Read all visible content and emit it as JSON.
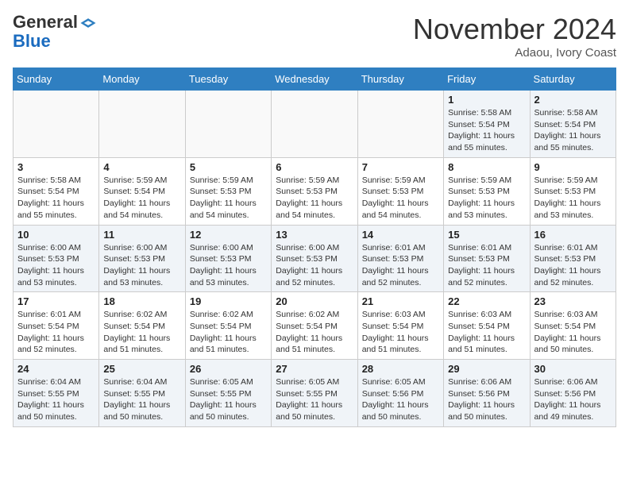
{
  "header": {
    "logo_line1": "General",
    "logo_line2": "Blue",
    "month_title": "November 2024",
    "location": "Adaou, Ivory Coast"
  },
  "weekdays": [
    "Sunday",
    "Monday",
    "Tuesday",
    "Wednesday",
    "Thursday",
    "Friday",
    "Saturday"
  ],
  "weeks": [
    [
      {
        "day": "",
        "info": ""
      },
      {
        "day": "",
        "info": ""
      },
      {
        "day": "",
        "info": ""
      },
      {
        "day": "",
        "info": ""
      },
      {
        "day": "",
        "info": ""
      },
      {
        "day": "1",
        "info": "Sunrise: 5:58 AM\nSunset: 5:54 PM\nDaylight: 11 hours and 55 minutes."
      },
      {
        "day": "2",
        "info": "Sunrise: 5:58 AM\nSunset: 5:54 PM\nDaylight: 11 hours and 55 minutes."
      }
    ],
    [
      {
        "day": "3",
        "info": "Sunrise: 5:58 AM\nSunset: 5:54 PM\nDaylight: 11 hours and 55 minutes."
      },
      {
        "day": "4",
        "info": "Sunrise: 5:59 AM\nSunset: 5:54 PM\nDaylight: 11 hours and 54 minutes."
      },
      {
        "day": "5",
        "info": "Sunrise: 5:59 AM\nSunset: 5:53 PM\nDaylight: 11 hours and 54 minutes."
      },
      {
        "day": "6",
        "info": "Sunrise: 5:59 AM\nSunset: 5:53 PM\nDaylight: 11 hours and 54 minutes."
      },
      {
        "day": "7",
        "info": "Sunrise: 5:59 AM\nSunset: 5:53 PM\nDaylight: 11 hours and 54 minutes."
      },
      {
        "day": "8",
        "info": "Sunrise: 5:59 AM\nSunset: 5:53 PM\nDaylight: 11 hours and 53 minutes."
      },
      {
        "day": "9",
        "info": "Sunrise: 5:59 AM\nSunset: 5:53 PM\nDaylight: 11 hours and 53 minutes."
      }
    ],
    [
      {
        "day": "10",
        "info": "Sunrise: 6:00 AM\nSunset: 5:53 PM\nDaylight: 11 hours and 53 minutes."
      },
      {
        "day": "11",
        "info": "Sunrise: 6:00 AM\nSunset: 5:53 PM\nDaylight: 11 hours and 53 minutes."
      },
      {
        "day": "12",
        "info": "Sunrise: 6:00 AM\nSunset: 5:53 PM\nDaylight: 11 hours and 53 minutes."
      },
      {
        "day": "13",
        "info": "Sunrise: 6:00 AM\nSunset: 5:53 PM\nDaylight: 11 hours and 52 minutes."
      },
      {
        "day": "14",
        "info": "Sunrise: 6:01 AM\nSunset: 5:53 PM\nDaylight: 11 hours and 52 minutes."
      },
      {
        "day": "15",
        "info": "Sunrise: 6:01 AM\nSunset: 5:53 PM\nDaylight: 11 hours and 52 minutes."
      },
      {
        "day": "16",
        "info": "Sunrise: 6:01 AM\nSunset: 5:53 PM\nDaylight: 11 hours and 52 minutes."
      }
    ],
    [
      {
        "day": "17",
        "info": "Sunrise: 6:01 AM\nSunset: 5:54 PM\nDaylight: 11 hours and 52 minutes."
      },
      {
        "day": "18",
        "info": "Sunrise: 6:02 AM\nSunset: 5:54 PM\nDaylight: 11 hours and 51 minutes."
      },
      {
        "day": "19",
        "info": "Sunrise: 6:02 AM\nSunset: 5:54 PM\nDaylight: 11 hours and 51 minutes."
      },
      {
        "day": "20",
        "info": "Sunrise: 6:02 AM\nSunset: 5:54 PM\nDaylight: 11 hours and 51 minutes."
      },
      {
        "day": "21",
        "info": "Sunrise: 6:03 AM\nSunset: 5:54 PM\nDaylight: 11 hours and 51 minutes."
      },
      {
        "day": "22",
        "info": "Sunrise: 6:03 AM\nSunset: 5:54 PM\nDaylight: 11 hours and 51 minutes."
      },
      {
        "day": "23",
        "info": "Sunrise: 6:03 AM\nSunset: 5:54 PM\nDaylight: 11 hours and 50 minutes."
      }
    ],
    [
      {
        "day": "24",
        "info": "Sunrise: 6:04 AM\nSunset: 5:55 PM\nDaylight: 11 hours and 50 minutes."
      },
      {
        "day": "25",
        "info": "Sunrise: 6:04 AM\nSunset: 5:55 PM\nDaylight: 11 hours and 50 minutes."
      },
      {
        "day": "26",
        "info": "Sunrise: 6:05 AM\nSunset: 5:55 PM\nDaylight: 11 hours and 50 minutes."
      },
      {
        "day": "27",
        "info": "Sunrise: 6:05 AM\nSunset: 5:55 PM\nDaylight: 11 hours and 50 minutes."
      },
      {
        "day": "28",
        "info": "Sunrise: 6:05 AM\nSunset: 5:56 PM\nDaylight: 11 hours and 50 minutes."
      },
      {
        "day": "29",
        "info": "Sunrise: 6:06 AM\nSunset: 5:56 PM\nDaylight: 11 hours and 50 minutes."
      },
      {
        "day": "30",
        "info": "Sunrise: 6:06 AM\nSunset: 5:56 PM\nDaylight: 11 hours and 49 minutes."
      }
    ]
  ]
}
